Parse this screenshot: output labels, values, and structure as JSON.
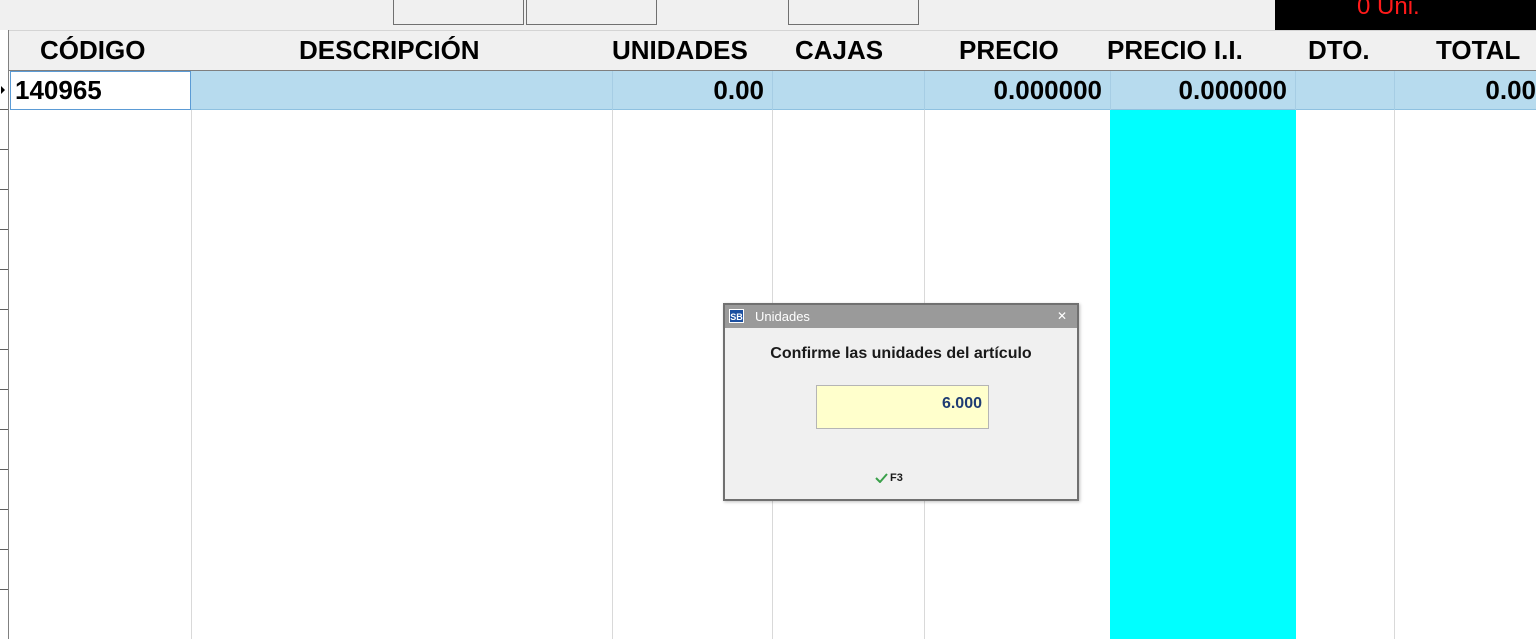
{
  "header_strip": {
    "units_display": "0 Uni."
  },
  "grid": {
    "columns": [
      {
        "key": "codigo",
        "label": "CÓDIGO"
      },
      {
        "key": "descripcion",
        "label": "DESCRIPCIÓN"
      },
      {
        "key": "unidades",
        "label": "UNIDADES"
      },
      {
        "key": "cajas",
        "label": "CAJAS"
      },
      {
        "key": "precio",
        "label": "PRECIO"
      },
      {
        "key": "precio_ii",
        "label": "PRECIO I.I."
      },
      {
        "key": "dto",
        "label": "DTO."
      },
      {
        "key": "total",
        "label": "TOTAL"
      }
    ],
    "rows": [
      {
        "codigo": "140965",
        "descripcion": "",
        "unidades": "0.00",
        "cajas": "",
        "precio": "0.000000",
        "precio_ii": "0.000000",
        "dto": "",
        "total": "0.00"
      }
    ]
  },
  "dialog": {
    "title": "Unidades",
    "app_icon_text": "SB",
    "close_icon": "close-icon",
    "message": "Confirme las unidades del artículo",
    "input_value": "6.000",
    "confirm_label": "F3",
    "confirm_icon": "check-icon"
  },
  "colors": {
    "highlight_column": "#00ffff",
    "row_selection": "#b7dbee",
    "units_display_text": "#ff1a1a",
    "input_background": "#ffffcc"
  }
}
